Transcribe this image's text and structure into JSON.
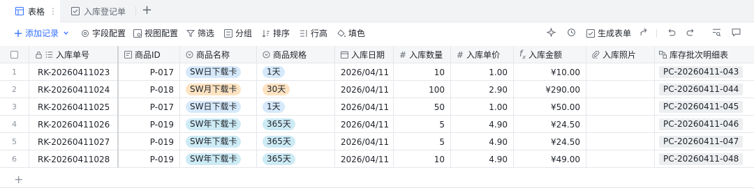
{
  "tabs": [
    {
      "label": "表格",
      "icon": "grid-table-icon",
      "active": true
    },
    {
      "label": "入库登记单",
      "icon": "form-icon",
      "active": false
    }
  ],
  "tab_more": "⋮",
  "tab_add": "+",
  "toolbar": {
    "add_record": "添加记录",
    "field_config": "字段配置",
    "view_config": "视图配置",
    "filter": "筛选",
    "group": "分组",
    "sort": "排序",
    "row_height": "行高",
    "fill": "填色",
    "generate_form": "生成表单"
  },
  "columns": {
    "no": "入库单号",
    "pid": "商品ID",
    "name": "商品名称",
    "spec": "商品规格",
    "date": "入库日期",
    "qty": "入库数量",
    "price": "入库单价",
    "amt": "入库金额",
    "photo": "入库照片",
    "batch": "库存批次明细表"
  },
  "rows": [
    {
      "idx": "1",
      "no": "RK-20260411023",
      "pid": "P-017",
      "name": "SW日下载卡",
      "spec": "1天",
      "date": "2026/04/11",
      "qty": "10",
      "price": "1.00",
      "amt": "¥10.00",
      "batch": "PC-20260411-043",
      "name_color": "blue",
      "spec_color": "blue"
    },
    {
      "idx": "2",
      "no": "RK-20260411024",
      "pid": "P-018",
      "name": "SW月下载卡",
      "spec": "30天",
      "date": "2026/04/11",
      "qty": "100",
      "price": "2.90",
      "amt": "¥290.00",
      "batch": "PC-20260411-044",
      "name_color": "orange",
      "spec_color": "orange"
    },
    {
      "idx": "3",
      "no": "RK-20260411025",
      "pid": "P-017",
      "name": "SW日下载卡",
      "spec": "1天",
      "date": "2026/04/11",
      "qty": "50",
      "price": "1.00",
      "amt": "¥50.00",
      "batch": "PC-20260411-045",
      "name_color": "blue",
      "spec_color": "blue"
    },
    {
      "idx": "4",
      "no": "RK-20260411026",
      "pid": "P-019",
      "name": "SW年下载卡",
      "spec": "365天",
      "date": "2026/04/11",
      "qty": "5",
      "price": "4.90",
      "amt": "¥24.50",
      "batch": "PC-20260411-046",
      "name_color": "cyan",
      "spec_color": "cyan"
    },
    {
      "idx": "5",
      "no": "RK-20260411027",
      "pid": "P-019",
      "name": "SW年下载卡",
      "spec": "365天",
      "date": "2026/04/11",
      "qty": "5",
      "price": "4.90",
      "amt": "¥24.50",
      "batch": "PC-20260411-047",
      "name_color": "cyan",
      "spec_color": "cyan"
    },
    {
      "idx": "6",
      "no": "RK-20260411028",
      "pid": "P-019",
      "name": "SW年下载卡",
      "spec": "365天",
      "date": "2026/04/11",
      "qty": "10",
      "price": "4.90",
      "amt": "¥49.00",
      "batch": "PC-20260411-048",
      "name_color": "cyan",
      "spec_color": "cyan"
    }
  ],
  "add_row_label": "+",
  "colors": {
    "accent": "#3370ff",
    "tag_blue": "#d6e9fb",
    "tag_orange": "#fde3c2",
    "tag_cyan": "#cdebf5"
  }
}
